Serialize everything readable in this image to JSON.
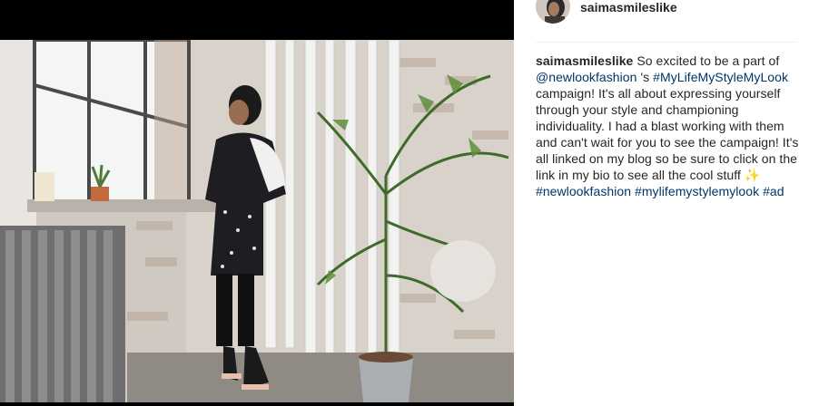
{
  "post": {
    "username": "saimasmileslike",
    "caption": {
      "intro": "So excited to be a part of",
      "mention": "@newlookfashion",
      "mention_suffix": "'s",
      "campaign_tag": "#MyLifeMyStyleMyLook",
      "body": "campaign! It's all about expressing yourself through your style and championing individuality. I had a blast working with them and can't wait for you to see the campaign! It's all linked on my blog so be sure to click on the link in my bio to see all the cool stuff",
      "emoji": "✨",
      "hashtags": [
        "#newlookfashion",
        "#mylifemystylemylook",
        "#ad"
      ]
    }
  },
  "colors": {
    "link": "#003569",
    "text": "#262626",
    "divider": "#efefef"
  },
  "icons": {
    "avatar": "profile-avatar-image",
    "sparkles": "sparkles-emoji"
  }
}
